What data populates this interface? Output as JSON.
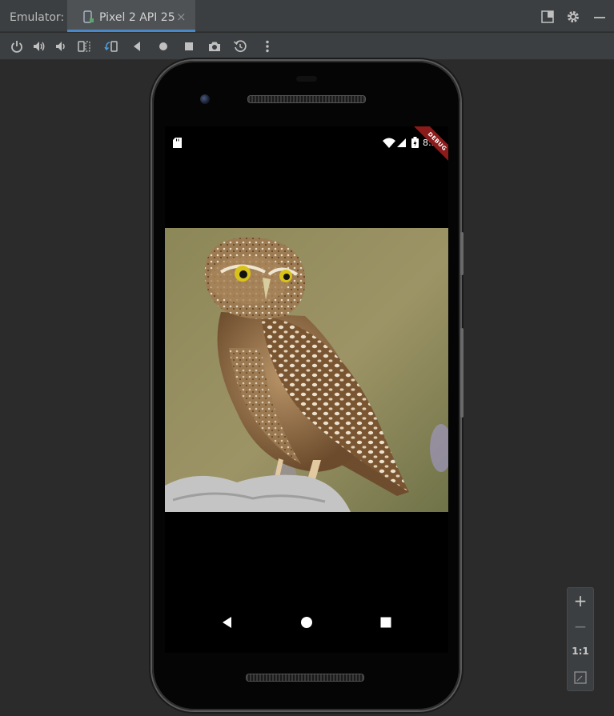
{
  "window": {
    "panel_label": "Emulator:",
    "tab_title": "Pixel 2 API 25",
    "tab_close": "×"
  },
  "toolbar": {
    "items": [
      "power-icon",
      "volume-up-icon",
      "volume-down-icon",
      "rotate-left-icon",
      "rotate-right-icon",
      "back-icon",
      "home-icon",
      "overview-icon",
      "screenshot-icon",
      "snapshot-icon",
      "more-icon"
    ]
  },
  "device": {
    "status_time": "8:52",
    "debug_banner": "DEBUG",
    "status_icons": [
      "sd-card-icon",
      "wifi-icon",
      "signal-icon",
      "battery-icon"
    ],
    "navigation": [
      "back-icon",
      "home-icon",
      "recents-icon"
    ]
  },
  "zoom": {
    "zoom_in": "+",
    "zoom_out": "−",
    "actual_size": "1:1"
  },
  "colors": {
    "accent": "#4a88c7",
    "ide_background": "#2b2b2b",
    "toolbar_background": "#3c3f41",
    "debug_ribbon": "#8b1a1a"
  }
}
